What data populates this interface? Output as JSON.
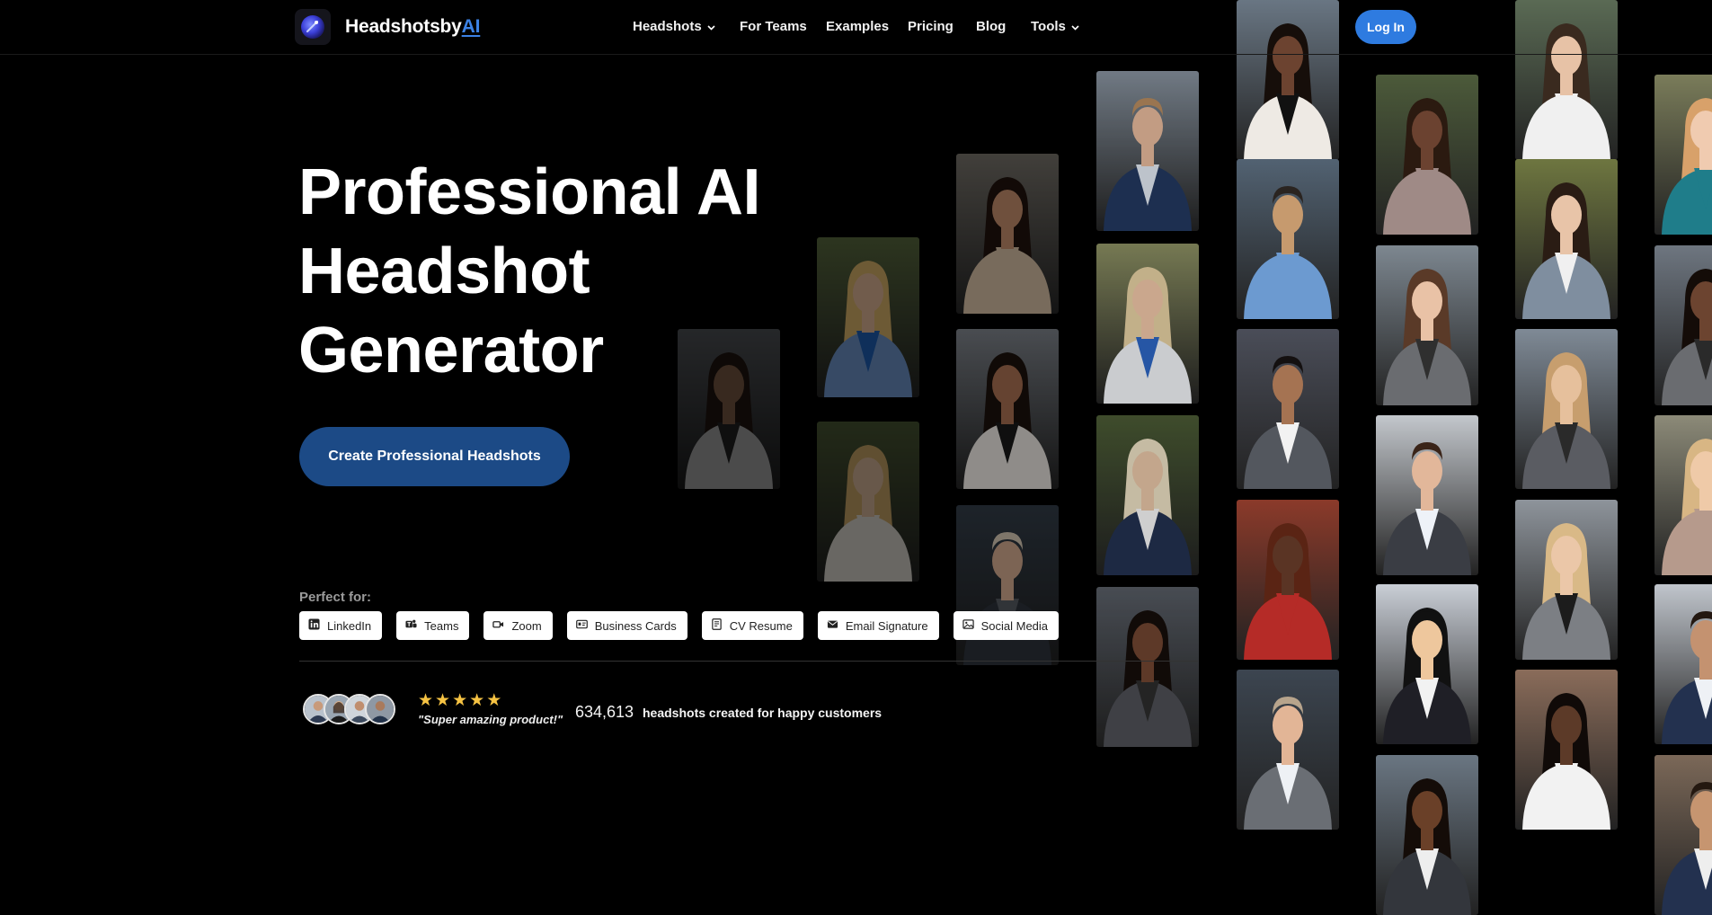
{
  "nav": {
    "brand_main": "Headshotsby",
    "brand_accent": "AI",
    "items": [
      {
        "label": "Headshots",
        "dropdown": true
      },
      {
        "label": "For Teams",
        "dropdown": false
      },
      {
        "label": "Examples",
        "dropdown": false
      },
      {
        "label": "Pricing",
        "dropdown": false
      },
      {
        "label": "Blog",
        "dropdown": false
      },
      {
        "label": "Tools",
        "dropdown": true
      }
    ],
    "login_label": "Log In"
  },
  "hero": {
    "title_line1": "Professional AI",
    "title_line2": "Headshot",
    "title_line3": "Generator",
    "cta_label": "Create Professional Headshots"
  },
  "perfect_for": {
    "label": "Perfect for:",
    "chips": [
      {
        "label": "LinkedIn",
        "icon": "linkedin-icon"
      },
      {
        "label": "Teams",
        "icon": "teams-icon"
      },
      {
        "label": "Zoom",
        "icon": "video-icon"
      },
      {
        "label": "Business Cards",
        "icon": "id-card-icon"
      },
      {
        "label": "CV Resume",
        "icon": "document-icon"
      },
      {
        "label": "Email Signature",
        "icon": "mail-icon"
      },
      {
        "label": "Social Media",
        "icon": "image-icon"
      }
    ]
  },
  "social_proof": {
    "stars": 5,
    "quote": "\"Super amazing product!\"",
    "count": "634,613",
    "count_label": "headshots created for happy customers"
  },
  "colors": {
    "background": "#000000",
    "brand_accent": "#3c82e6",
    "cta": "#1c4a86",
    "login": "#2e7be0",
    "stars": "#f6c343"
  }
}
